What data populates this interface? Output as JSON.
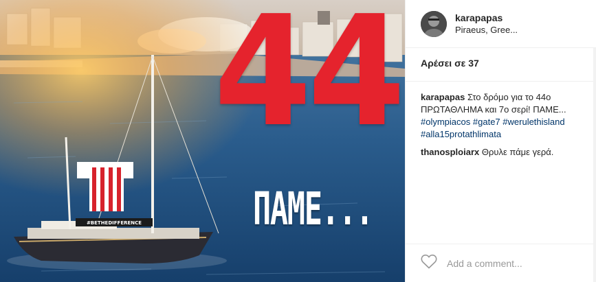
{
  "post": {
    "image": {
      "number_text": "44",
      "word_text": "ΠΑΜΕ...",
      "banner_text": "#BETHEDIFFERENCE",
      "brand_red": "#e5232d"
    },
    "header": {
      "username": "karapapas",
      "location": "Piraeus, Gree..."
    },
    "likes_text": "Αρέσει σε 37",
    "comments": [
      {
        "user": "karapapas",
        "text": " Στο δρόμο για το 44ο ΠΡΩΤΑΘΛΗΜΑ και 7ο σερί! ΠΑΜΕ... ",
        "tags": [
          "#olympiacos",
          "#gate7",
          "#werulethisland",
          "#alla15protathlimata"
        ]
      },
      {
        "user": "thanosploiarx",
        "text": " Θρυλε πάμε γερά."
      }
    ],
    "add_comment_placeholder": "Add a comment...",
    "icons": {
      "like": "heart-outline-icon"
    }
  }
}
